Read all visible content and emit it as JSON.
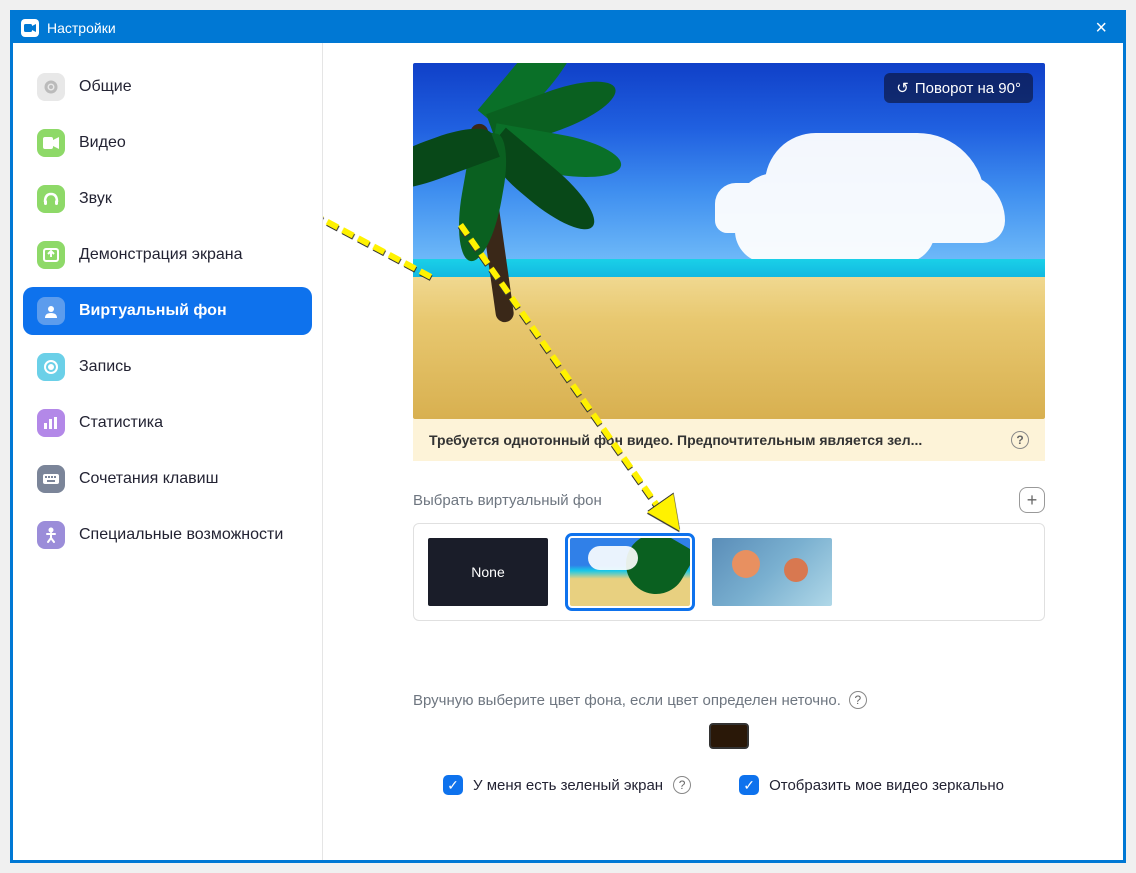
{
  "window": {
    "title": "Настройки"
  },
  "sidebar": {
    "items": [
      {
        "label": "Общие"
      },
      {
        "label": "Видео"
      },
      {
        "label": "Звук"
      },
      {
        "label": "Демонстрация экрана"
      },
      {
        "label": "Виртуальный фон"
      },
      {
        "label": "Запись"
      },
      {
        "label": "Статистика"
      },
      {
        "label": "Сочетания клавиш"
      },
      {
        "label": "Специальные возможности"
      }
    ]
  },
  "preview": {
    "rotate_label": "Поворот на 90°"
  },
  "warning": {
    "text": "Требуется однотонный фон видео. Предпочтительным является зел..."
  },
  "section": {
    "choose_label": "Выбрать виртуальный фон"
  },
  "thumbs": {
    "none_label": "None"
  },
  "manual": {
    "text": "Вручную выберите цвет фона, если цвет определен неточно."
  },
  "checkboxes": {
    "green_screen": "У меня есть зеленый экран",
    "mirror": "Отобразить мое видео зеркально"
  },
  "colors": {
    "accent": "#0e72ed",
    "swatch": "#2a1808"
  }
}
